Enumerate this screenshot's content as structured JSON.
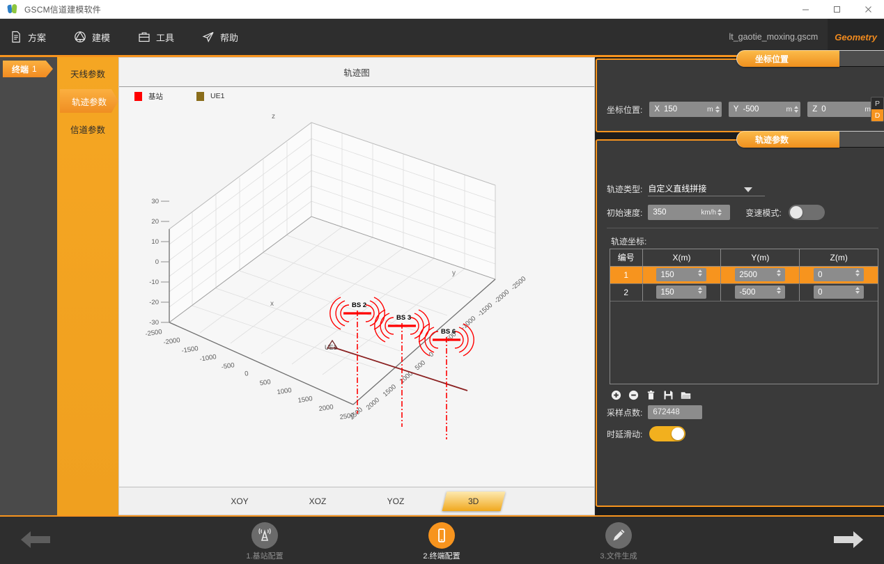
{
  "window": {
    "title": "GSCM信道建模软件",
    "app_icon": "app-logo-icon",
    "minimize": "minimize-icon",
    "maximize": "maximize-icon",
    "close": "close-icon"
  },
  "menubar": {
    "items": [
      {
        "label": "方案",
        "icon": "document-icon"
      },
      {
        "label": "建模",
        "icon": "modeling-icon"
      },
      {
        "label": "工具",
        "icon": "toolbox-icon"
      },
      {
        "label": "帮助",
        "icon": "paper-plane-icon"
      }
    ],
    "filename": "lt_gaotie_moxing.gscm",
    "mode_tab": "Geometry"
  },
  "left_rail": {
    "items": [
      {
        "label": "终端",
        "number": "1",
        "selected": true
      }
    ]
  },
  "sub_sidebar": {
    "items": [
      {
        "label": "天线参数",
        "selected": false
      },
      {
        "label": "轨迹参数",
        "selected": true
      },
      {
        "label": "信道参数",
        "selected": false
      }
    ]
  },
  "plot": {
    "title": "轨迹图",
    "legend": [
      {
        "label": "基站",
        "color": "#ff0000"
      },
      {
        "label": "UE1",
        "color": "#8a6d1b"
      }
    ],
    "view_tabs": [
      {
        "label": "XOY",
        "selected": false
      },
      {
        "label": "XOZ",
        "selected": false
      },
      {
        "label": "YOZ",
        "selected": false
      },
      {
        "label": "3D",
        "selected": true
      }
    ]
  },
  "chart_data": {
    "type": "scatter",
    "title": "轨迹图",
    "projection": "3d",
    "xlabel": "x",
    "ylabel": "y",
    "zlabel": "z",
    "xlim": [
      -2500,
      2500
    ],
    "ylim": [
      -2500,
      2500
    ],
    "zlim": [
      -30,
      30
    ],
    "xticks": [
      -2500,
      -2000,
      -1500,
      -1000,
      -500,
      0,
      500,
      1000,
      1500,
      2000,
      2500
    ],
    "yticks": [
      -2500,
      -2000,
      -1500,
      -1000,
      -500,
      0,
      500,
      1000,
      1500,
      2000,
      2500
    ],
    "zticks": [
      -30,
      -20,
      -10,
      0,
      10,
      20,
      30
    ],
    "grid": true,
    "legend_position": "top-left",
    "series": [
      {
        "name": "基站",
        "type": "markers",
        "color": "#ff0000",
        "points": [
          {
            "label": "BS 2",
            "x": 150,
            "y": 1500,
            "z": 30
          },
          {
            "label": "BS 3",
            "x": 150,
            "y": 500,
            "z": 30
          },
          {
            "label": "BS 6",
            "x": 150,
            "y": -500,
            "z": 30
          }
        ]
      },
      {
        "name": "UE1",
        "type": "line",
        "color": "#8a2020",
        "points": [
          {
            "label": "UE1",
            "x": 150,
            "y": 2500,
            "z": 0
          },
          {
            "label": "",
            "x": 150,
            "y": -500,
            "z": 0
          }
        ]
      }
    ]
  },
  "coord_panel": {
    "tab_label": "坐标位置",
    "row_label": "坐标位置:",
    "fields": [
      {
        "axis": "X",
        "value": "150",
        "unit": "m"
      },
      {
        "axis": "Y",
        "value": "-500",
        "unit": "m"
      },
      {
        "axis": "Z",
        "value": "0",
        "unit": "m"
      }
    ],
    "pd_toggle": {
      "p": "P",
      "d": "D",
      "selected": "D"
    }
  },
  "traj_panel": {
    "tab_label": "轨迹参数",
    "type_label": "轨迹类型:",
    "type_value": "自定义直线拼接",
    "speed_label": "初始速度:",
    "speed_value": "350",
    "speed_unit": "km/h",
    "varspeed_label": "变速模式:",
    "varspeed_on": false,
    "coords_caption": "轨迹坐标:",
    "table": {
      "headers": [
        "编号",
        "X(m)",
        "Y(m)",
        "Z(m)"
      ],
      "rows": [
        {
          "idx": "1",
          "x": "150",
          "y": "2500",
          "z": "0",
          "selected": true
        },
        {
          "idx": "2",
          "x": "150",
          "y": "-500",
          "z": "0",
          "selected": false
        }
      ]
    },
    "actions": [
      {
        "name": "add-icon"
      },
      {
        "name": "remove-icon"
      },
      {
        "name": "delete-icon"
      },
      {
        "name": "save-icon"
      },
      {
        "name": "open-folder-icon"
      }
    ],
    "sample_label": "采样点数:",
    "sample_value": "672448",
    "delay_label": "时延滑动:",
    "delay_on": true
  },
  "bottom": {
    "prev": "prev-arrow-icon",
    "next": "next-arrow-icon",
    "steps": [
      {
        "label": "1.基站配置",
        "icon": "basestation-icon",
        "active": false
      },
      {
        "label": "2.终端配置",
        "icon": "phone-icon",
        "active": true
      },
      {
        "label": "3.文件生成",
        "icon": "pencil-icon",
        "active": false
      }
    ]
  },
  "colors": {
    "accent": "#f7941e",
    "panel_bg": "#3a3a3a",
    "chrome_bg": "#2e2e2e",
    "bs_red": "#ff0000",
    "ue_brown": "#8a2020"
  }
}
